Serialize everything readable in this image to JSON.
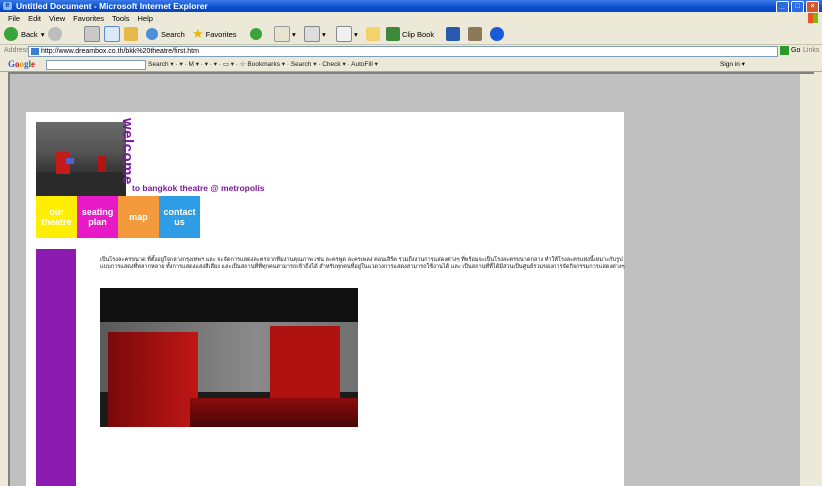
{
  "window": {
    "title": "Untitled Document - Microsoft Internet Explorer",
    "controls": [
      "_",
      "□",
      "×"
    ]
  },
  "menu": [
    "File",
    "Edit",
    "View",
    "Favorites",
    "Tools",
    "Help"
  ],
  "toolbar": {
    "back": "Back",
    "search": "Search",
    "favorites": "Favorites",
    "clip_book": "Clip Book"
  },
  "address": {
    "label": "Address",
    "url": "http://www.dreambox.co.th/bkk%20theatre/first.htm",
    "go": "Go",
    "links": "Links"
  },
  "googlebar": {
    "logo": "Google",
    "input_value": "",
    "items": "Search ▾ · ▾ · M ▾ · ▾ · ▾ · ▭ ▾ · ☆ Bookmarks ▾ · Search ▾ · Check ▾ · AutoFill ▾",
    "right": "Sign in ▾"
  },
  "site": {
    "welcome": "welcome",
    "subtitle": "to bangkok theatre @ metropolis",
    "nav": [
      {
        "label": "our theatre",
        "color": "#ffee00"
      },
      {
        "label": "seating plan",
        "color": "#e81ac8"
      },
      {
        "label": "map",
        "color": "#f39a3c"
      },
      {
        "label": "contact us",
        "color": "#2e9de6"
      }
    ],
    "paragraph": "เป็นโรงละครขนาด ที่ตั้งอยู่ใจกลางกรุงเทพฯ และ จะจัดการแสดงละครจากทีมงานคุณภาพ เช่น ละครพูด ละครเพลง คอนเสิร์ต รวมถึงงานการแสดงต่างๆ ที่พร้อมจะเป็นโรงละครขนาดกลาง ทำให้โรงละครแห่งนี้เหมาะกับรูปแบบการแสดงที่หลากหลาย ทั้งการแสดงแสงสีเสียง และเป็นสถานที่ที่ทุกคนสามารถเข้าถึงได้ สำหรับทุกคนที่อยู่ในแวดวงการแสดงสามารถใช้งานได้ และ เป็นสถานที่ที่ได้มีส่วนเป็นศูนย์รวมของการจัดกิจกรรมการแสดงต่างๆ"
  }
}
